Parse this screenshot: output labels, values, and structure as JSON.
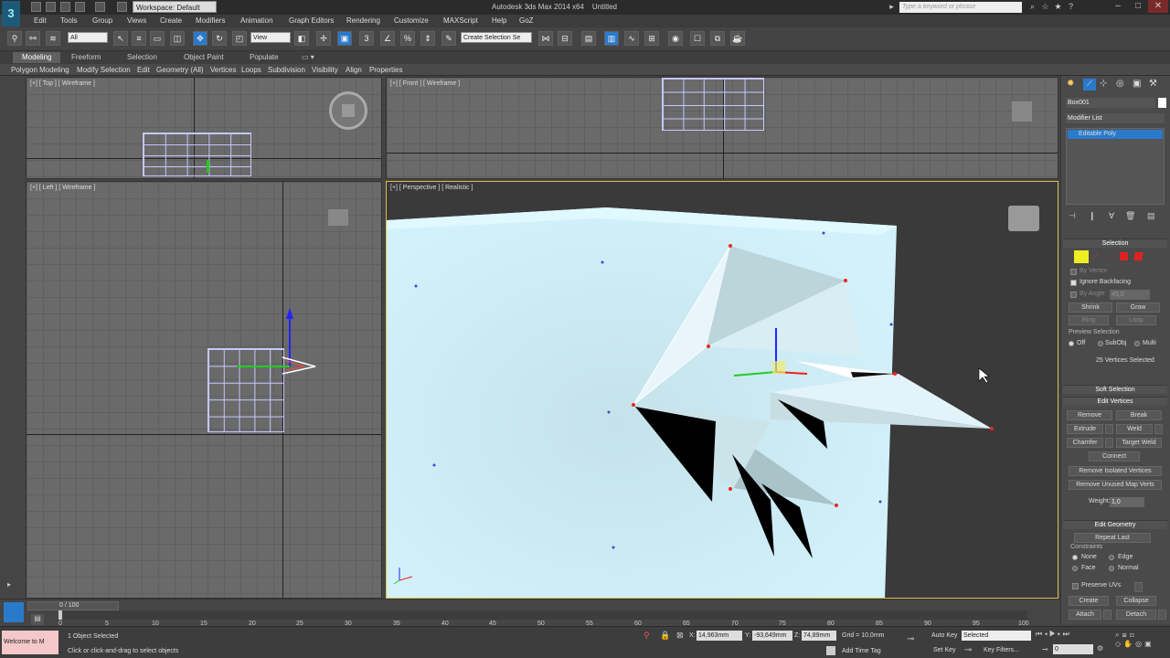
{
  "title_bar": {
    "workspace": "Workspace: Default",
    "app_title": "Autodesk 3ds Max 2014 x64",
    "file_name": "Untitled",
    "search_placeholder": "Type a keyword or phrase"
  },
  "menu": [
    "Edit",
    "Tools",
    "Group",
    "Views",
    "Create",
    "Modifiers",
    "Animation",
    "Graph Editors",
    "Rendering",
    "Customize",
    "MAXScript",
    "Help",
    "GoZ"
  ],
  "toolbar": {
    "selection_filter": "All",
    "ref_coord": "View",
    "named_selection": "Create Selection Se"
  },
  "ribbon": {
    "tabs": [
      "Modeling",
      "Freeform",
      "Selection",
      "Object Paint",
      "Populate"
    ],
    "panels": [
      "Polygon Modeling",
      "Modify Selection",
      "Edit",
      "Geometry (All)",
      "Vertices",
      "Loops",
      "Subdivision",
      "Visibility",
      "Align",
      "Properties"
    ]
  },
  "viewports": {
    "top": "[+] [ Top ] [ Wireframe ]",
    "front": "[+] [ Front ] [ Wireframe ]",
    "left": "[+] [ Left ] [ Wireframe ]",
    "perspective": "[+] [ Perspective ] [ Realistic ]"
  },
  "command_panel": {
    "object_name": "Box001",
    "modifier_list": "Modifier List",
    "stack_item": "Editable Poly",
    "selection_head": "Selection",
    "by_vertex": "By Vertex",
    "ignore_backfacing": "Ignore Backfacing",
    "by_angle": "By Angle:",
    "angle_value": "45,0",
    "shrink": "Shrink",
    "grow": "Grow",
    "ring": "Ring",
    "loop": "Loop",
    "preview_selection": "Preview Selection",
    "preview_off": "Off",
    "preview_subobj": "SubObj",
    "preview_multi": "Multi",
    "selected_count": "25 Vertices Selected",
    "soft_selection": "Soft Selection",
    "edit_vertices": "Edit Vertices",
    "remove": "Remove",
    "break": "Break",
    "extrude": "Extrude",
    "weld": "Weld",
    "chamfer": "Chamfer",
    "target_weld": "Target Weld",
    "connect": "Connect",
    "remove_isolated": "Remove Isolated Vertices",
    "remove_unused": "Remove Unused Map Verts",
    "weight_label": "Weight:",
    "weight_value": "1,0",
    "edit_geometry": "Edit Geometry",
    "repeat_last": "Repeat Last",
    "constraints": "Constraints",
    "c_none": "None",
    "c_edge": "Edge",
    "c_face": "Face",
    "c_normal": "Normal",
    "preserve_uvs": "Preserve UVs",
    "create": "Create",
    "collapse": "Collapse",
    "attach": "Attach",
    "detach": "Detach"
  },
  "timeline": {
    "frame": "0 / 100",
    "ticks": [
      "0",
      "5",
      "10",
      "15",
      "20",
      "25",
      "30",
      "35",
      "40",
      "45",
      "50",
      "55",
      "60",
      "65",
      "70",
      "75",
      "80",
      "85",
      "90",
      "95",
      "100"
    ]
  },
  "status": {
    "maxscript": "Welcome to M",
    "selected": "1 Object Selected",
    "prompt": "Click or click-and-drag to select objects",
    "x_label": "X:",
    "x": "14,963mm",
    "y_label": "Y:",
    "y": "-93,649mm",
    "z_label": "Z:",
    "z": "74,89mm",
    "grid": "Grid = 10,0mm",
    "add_time_tag": "Add Time Tag",
    "auto_key": "Auto Key",
    "key_mode": "Selected",
    "set_key": "Set Key",
    "key_filters": "Key Filters...",
    "current_frame": "0"
  }
}
